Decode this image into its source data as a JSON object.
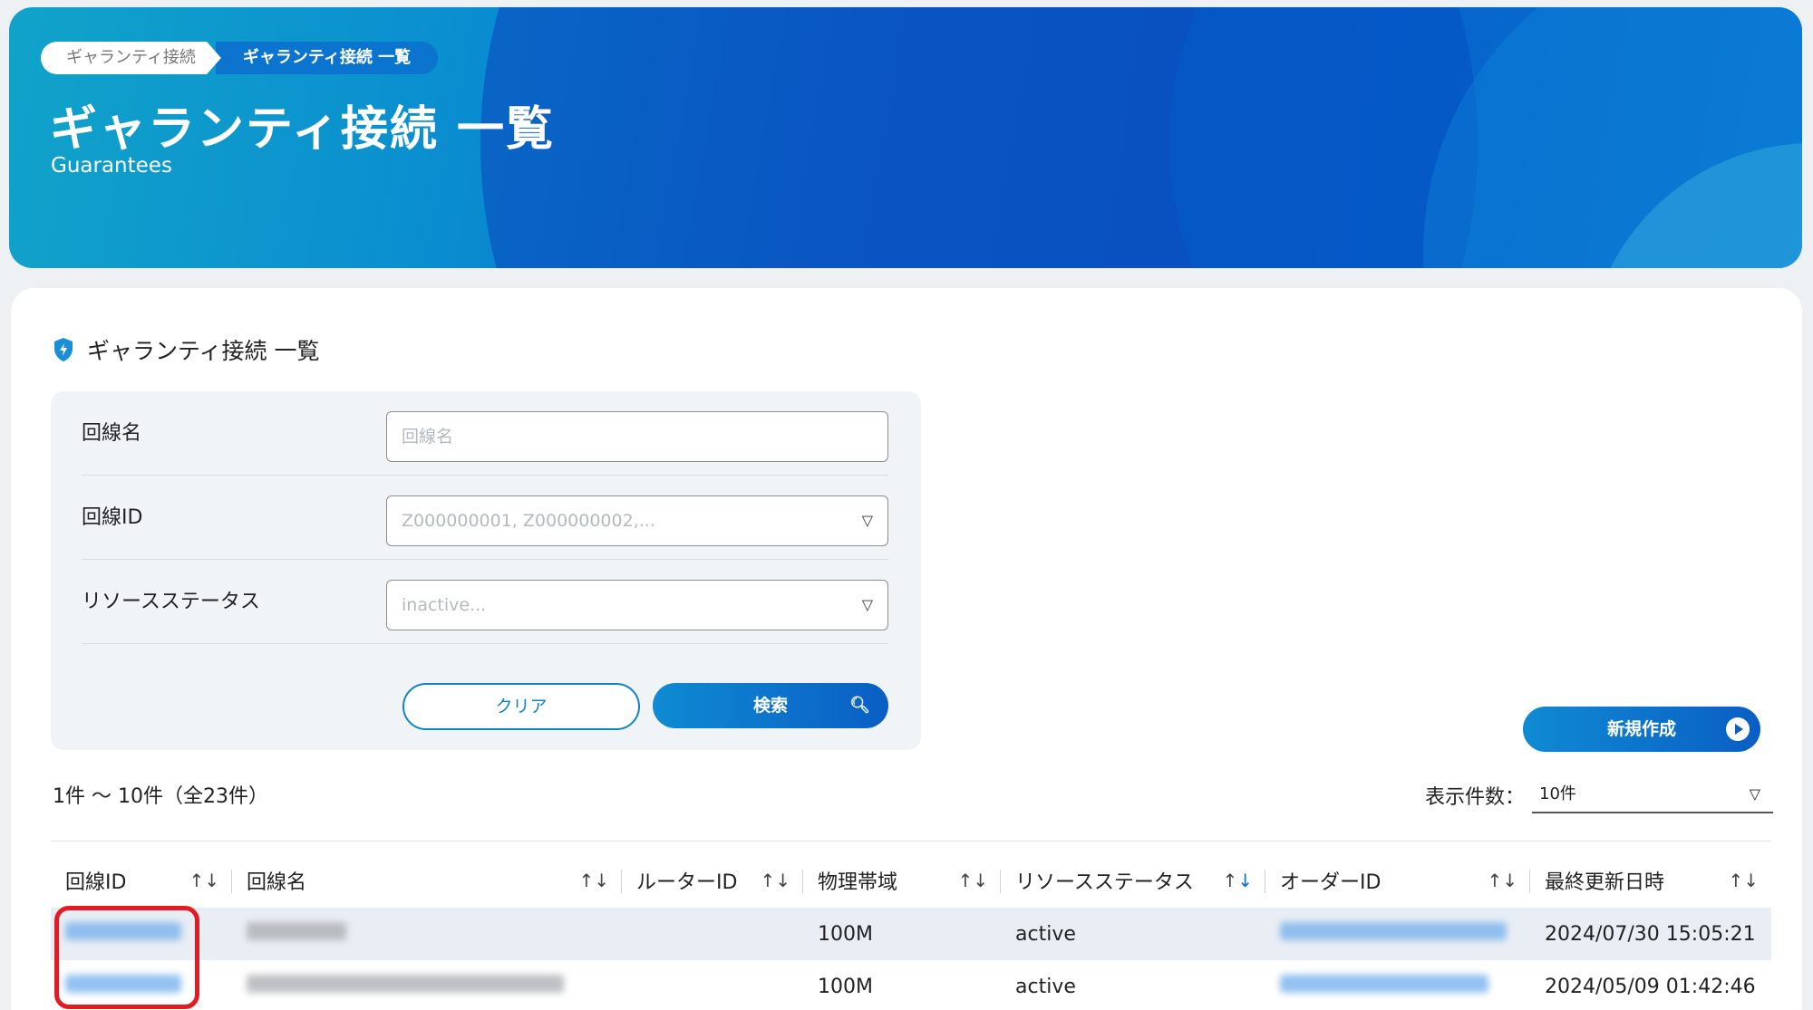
{
  "breadcrumb": [
    "ギャランティ接続",
    "ギャランティ接続 一覧"
  ],
  "hero": {
    "title": "ギャランティ接続 一覧",
    "subtitle": "Guarantees"
  },
  "section_title": "ギャランティ接続 一覧",
  "filters": {
    "line_name": {
      "label": "回線名",
      "placeholder": "回線名"
    },
    "line_id": {
      "label": "回線ID",
      "placeholder": "Z000000001, Z000000002,..."
    },
    "resource_status": {
      "label": "リソースステータス",
      "placeholder": "inactive..."
    }
  },
  "buttons": {
    "clear": "クリア",
    "search": "検索",
    "new": "新規作成"
  },
  "result_count": "1件 〜 10件（全23件）",
  "per_page": {
    "label": "表示件数：",
    "value": "10件"
  },
  "table": {
    "columns": [
      "回線ID",
      "回線名",
      "ルーターID",
      "物理帯域",
      "リソースステータス",
      "オーダーID",
      "最終更新日時"
    ],
    "sort_arrows": "↑↓",
    "rows": [
      {
        "bandwidth": "100M",
        "status": "active",
        "updated": "2024/07/30 15:05:21"
      },
      {
        "bandwidth": "100M",
        "status": "active",
        "updated": "2024/05/09 01:42:46"
      }
    ]
  },
  "colors": {
    "accent": "#0a6fd1",
    "highlight": "#e41b23"
  },
  "icons": [
    "shield-icon",
    "chevron-down-icon",
    "search-icon",
    "play-circle-icon"
  ]
}
